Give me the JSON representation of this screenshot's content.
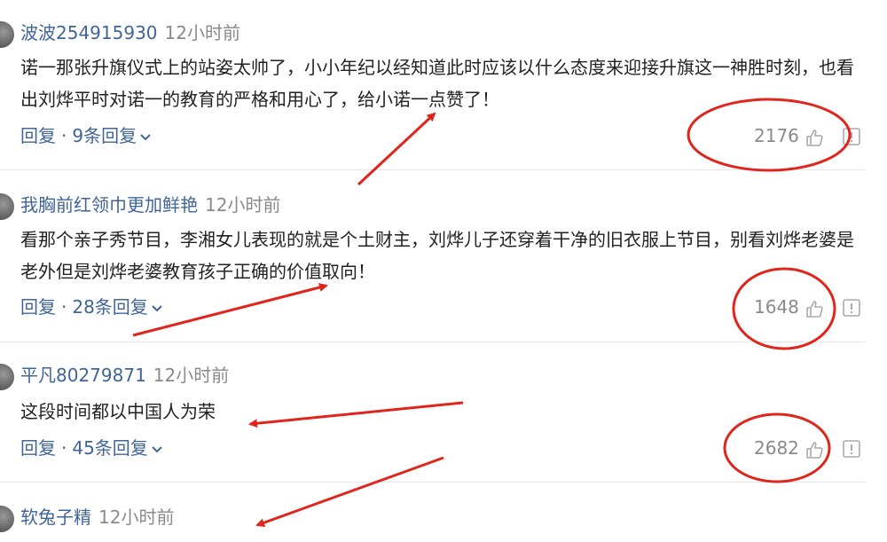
{
  "comments": [
    {
      "user": "波波254915930",
      "time": "12小时前",
      "text": "诺一那张升旗仪式上的站姿太帅了，小小年纪以经知道此时应该以什么态度来迎接升旗这一神胜时刻，也看出刘烨平时对诺一的教育的严格和用心了，给小诺一点赞了！",
      "reply_label": "回复",
      "replies_label": "9条回复",
      "likes": "2176"
    },
    {
      "user": "我胸前红领巾更加鲜艳",
      "time": "12小时前",
      "text": "看那个亲子秀节目，李湘女儿表现的就是个土财主，刘烨儿子还穿着干净的旧衣服上节目，别看刘烨老婆是老外但是刘烨老婆教育孩子正确的价值取向！",
      "reply_label": "回复",
      "replies_label": "28条回复",
      "likes": "1648"
    },
    {
      "user": "平凡80279871",
      "time": "12小时前",
      "text": "这段时间都以中国人为荣",
      "reply_label": "回复",
      "replies_label": "45条回复",
      "likes": "2682"
    },
    {
      "user": "软兔子精",
      "time": "12小时前"
    }
  ],
  "colors": {
    "username": "#406599",
    "timestamp": "#8a8a8a",
    "body_text": "#222222",
    "annotation": "#e0261c"
  }
}
